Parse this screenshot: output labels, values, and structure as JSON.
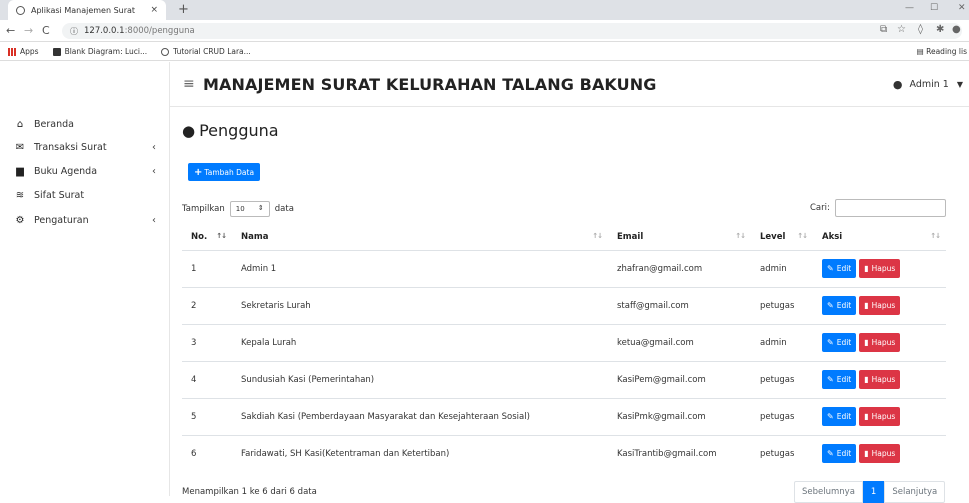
{
  "browser": {
    "tab_title": "Aplikasi Manajemen Surat",
    "tab_close": "×",
    "new_tab": "+",
    "url_host": "127.0.0.1",
    "url_rest": ":8000/pengguna",
    "bookmarks": [
      "Apps",
      "Blank Diagram: Luci...",
      "Tutorial CRUD Lara..."
    ],
    "reading_list": "Reading lis"
  },
  "sidebar": {
    "items": [
      {
        "label": "Beranda",
        "icon": "home-icon",
        "has_submenu": false
      },
      {
        "label": "Transaksi Surat",
        "icon": "mail-truck-icon",
        "has_submenu": true
      },
      {
        "label": "Buku Agenda",
        "icon": "book-icon",
        "has_submenu": true
      },
      {
        "label": "Sifat Surat",
        "icon": "layers-icon",
        "has_submenu": false
      },
      {
        "label": "Pengaturan",
        "icon": "cogs-icon",
        "has_submenu": true
      }
    ]
  },
  "header": {
    "title": "MANAJEMEN SURAT KELURAHAN TALANG BAKUNG",
    "user": "Admin 1"
  },
  "page": {
    "title": "Pengguna",
    "add_button": "Tambah Data",
    "length_prefix": "Tampilkan",
    "length_value": "10",
    "length_suffix": "data",
    "search_label": "Cari:",
    "columns": [
      "No.",
      "Nama",
      "Email",
      "Level",
      "Aksi"
    ],
    "rows": [
      {
        "no": "1",
        "nama": "Admin 1",
        "email": "zhafran@gmail.com",
        "level": "admin"
      },
      {
        "no": "2",
        "nama": "Sekretaris Lurah",
        "email": "staff@gmail.com",
        "level": "petugas"
      },
      {
        "no": "3",
        "nama": "Kepala Lurah",
        "email": "ketua@gmail.com",
        "level": "admin"
      },
      {
        "no": "4",
        "nama": "Sundusiah Kasi (Pemerintahan)",
        "email": "KasiPem@gmail.com",
        "level": "petugas"
      },
      {
        "no": "5",
        "nama": "Sakdiah Kasi (Pemberdayaan Masyarakat dan Kesejahteraan Sosial)",
        "email": "KasiPmk@gmail.com",
        "level": "petugas"
      },
      {
        "no": "6",
        "nama": "Faridawati, SH Kasi(Ketentraman dan Ketertiban)",
        "email": "KasiTrantib@gmail.com",
        "level": "petugas"
      }
    ],
    "edit_label": "Edit",
    "delete_label": "Hapus",
    "info": "Menampilkan 1 ke 6 dari 6 data",
    "pager": {
      "prev": "Sebelumnya",
      "current": "1",
      "next": "Selanjutya"
    }
  },
  "colors": {
    "primary": "#007bff",
    "danger": "#dc3545"
  }
}
